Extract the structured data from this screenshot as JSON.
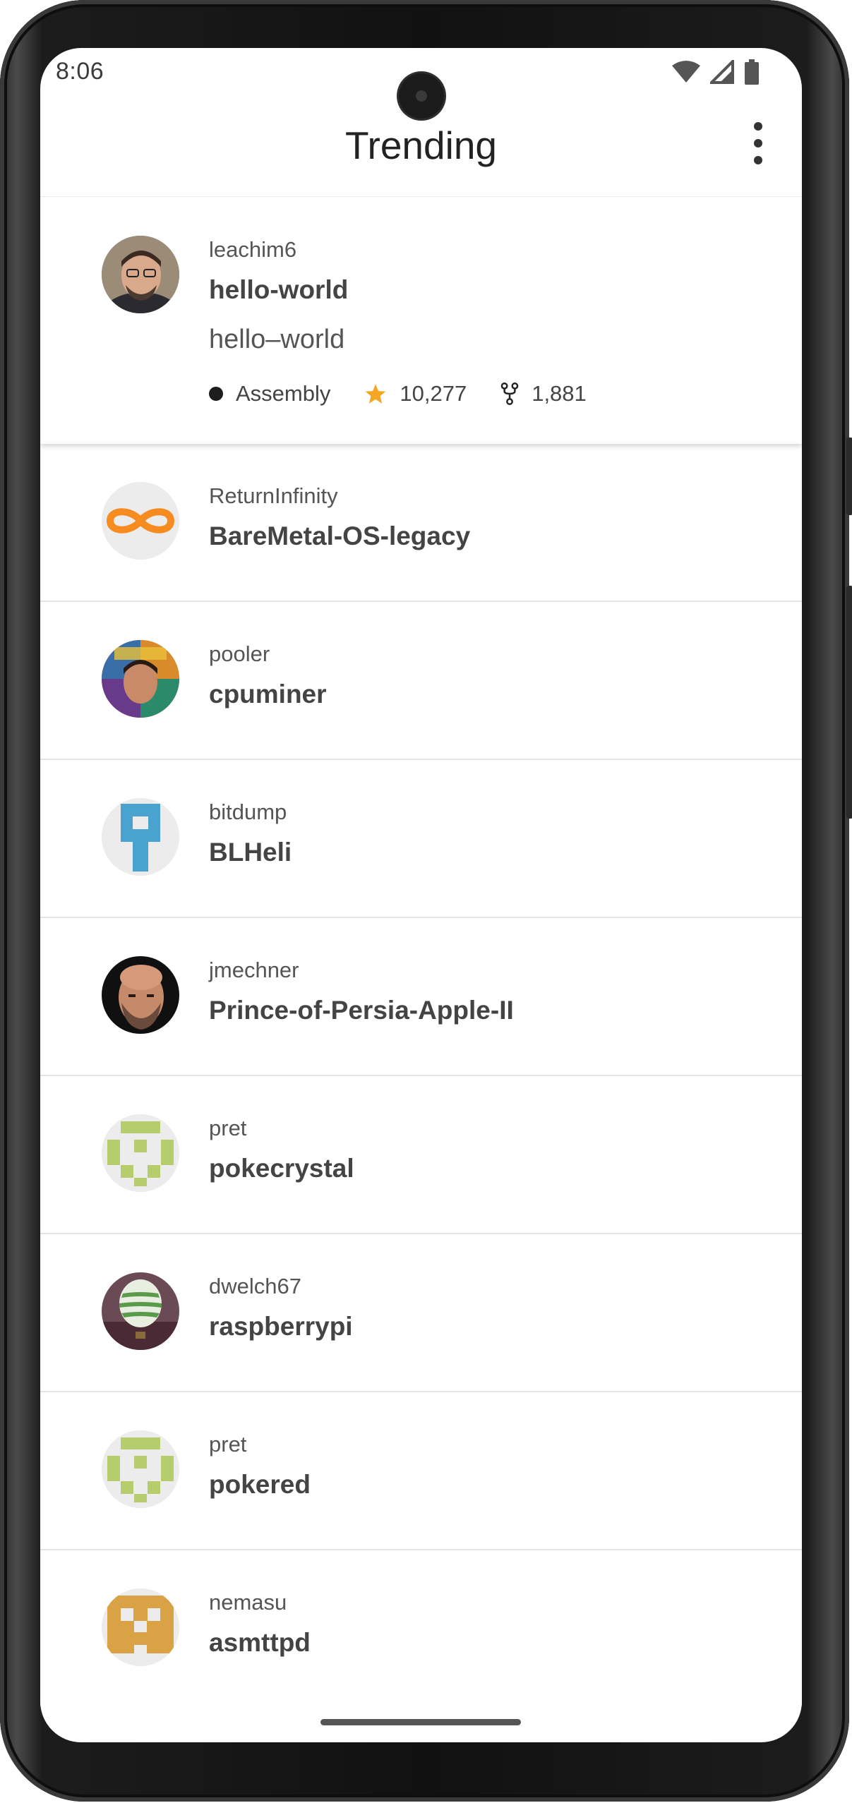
{
  "status_bar": {
    "time": "8:06",
    "icons": [
      "wifi-icon",
      "signal-icon",
      "battery-icon"
    ]
  },
  "app_bar": {
    "title": "Trending",
    "menu_icon": "more-vert-icon"
  },
  "repos": [
    {
      "owner": "leachim6",
      "name": "hello-world",
      "description": "hello–world",
      "language": "Assembly",
      "language_color": "#1d1d1d",
      "stars": "10,277",
      "forks": "1,881",
      "avatar": "photo-avatar"
    },
    {
      "owner": "ReturnInfinity",
      "name": "BareMetal-OS-legacy",
      "avatar": "infinity-avatar"
    },
    {
      "owner": "pooler",
      "name": "cpuminer",
      "avatar": "book-cover-avatar"
    },
    {
      "owner": "bitdump",
      "name": "BLHeli",
      "avatar": "pixel-blue-avatar"
    },
    {
      "owner": "jmechner",
      "name": "Prince-of-Persia-Apple-II",
      "avatar": "photo-avatar"
    },
    {
      "owner": "pret",
      "name": "pokecrystal",
      "avatar": "pixel-green-avatar"
    },
    {
      "owner": "dwelch67",
      "name": "raspberrypi",
      "avatar": "balloon-avatar"
    },
    {
      "owner": "pret",
      "name": "pokered",
      "avatar": "pixel-green-avatar"
    },
    {
      "owner": "nemasu",
      "name": "asmttpd",
      "avatar": "pixel-orange-avatar"
    }
  ],
  "colors": {
    "star": "#f5a623",
    "infinity": "#f68b1f",
    "pixel_blue": "#4aa3cf",
    "pixel_green": "#b5cd6c",
    "pixel_orange": "#d9a245"
  }
}
